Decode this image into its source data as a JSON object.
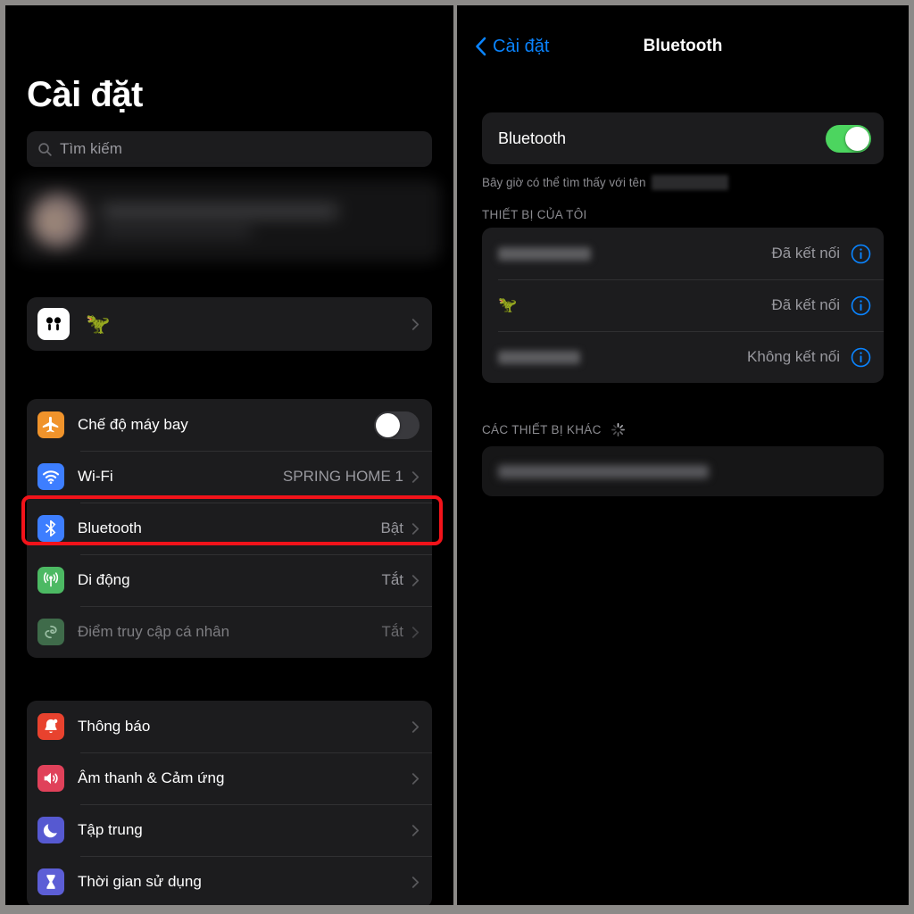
{
  "left_panel": {
    "title": "Cài đặt",
    "search": {
      "placeholder": "Tìm kiếm",
      "icon": "search-icon"
    },
    "profile_banner": {
      "redacted": true,
      "icon": "avatar"
    },
    "airpods_row": {
      "icon": "airpods-icon",
      "label": "🦖",
      "chevron": "chevron-right-icon"
    },
    "group_connectivity": [
      {
        "label": "Chế độ máy bay",
        "icon": "airplane-icon",
        "color": "#f0932b",
        "control": "toggle",
        "toggle_on": false
      },
      {
        "label": "Wi-Fi",
        "icon": "wifi-icon",
        "color": "#3d7eff",
        "value": "SPRING HOME 1",
        "control": "chevron"
      },
      {
        "label": "Bluetooth",
        "icon": "bluetooth-icon",
        "color": "#3d7eff",
        "value": "Bật",
        "control": "chevron",
        "highlighted": true
      },
      {
        "label": "Di động",
        "icon": "cellular-icon",
        "color": "#4cb963",
        "value": "Tắt",
        "control": "chevron"
      },
      {
        "label": "Điểm truy cập cá nhân",
        "icon": "hotspot-icon",
        "color": "#3f6b4a",
        "value": "Tắt",
        "control": "chevron",
        "disabled": true
      }
    ],
    "group_system": [
      {
        "label": "Thông báo",
        "icon": "bell-icon",
        "color": "#e8422e",
        "control": "chevron"
      },
      {
        "label": "Âm thanh & Cảm ứng",
        "icon": "speaker-icon",
        "color": "#e0415a",
        "control": "chevron"
      },
      {
        "label": "Tập trung",
        "icon": "moon-icon",
        "color": "#5659d1",
        "control": "chevron"
      },
      {
        "label": "Thời gian sử dụng",
        "icon": "hourglass-icon",
        "color": "#5c5ed6",
        "control": "chevron"
      }
    ]
  },
  "right_panel": {
    "back_label": "Cài đặt",
    "title": "Bluetooth",
    "bluetooth_toggle": {
      "label": "Bluetooth",
      "on": true
    },
    "discoverable_note": "Bây giờ có thể tìm thấy với tên",
    "my_devices_header": "THIẾT BỊ CỦA TÔI",
    "devices": [
      {
        "name": "",
        "redacted": true,
        "status": "Đã kết nối",
        "info": "info-icon"
      },
      {
        "name": "🦖",
        "redacted": false,
        "status": "Đã kết nối",
        "info": "info-icon",
        "highlighted": true
      },
      {
        "name": "",
        "redacted": true,
        "status": "Không kết nối",
        "info": "info-icon"
      }
    ],
    "other_devices_header": "CÁC THIẾT BỊ KHÁC",
    "other_devices_spinner": true,
    "other_devices": [
      {
        "name": "",
        "redacted": true
      }
    ]
  },
  "annotations": {
    "highlight_color": "#f2131a",
    "arrow_color": "#d93b38",
    "bluetooth_row_box": true,
    "info_button_box": true,
    "arrow_pointing_to": "info-icon"
  }
}
